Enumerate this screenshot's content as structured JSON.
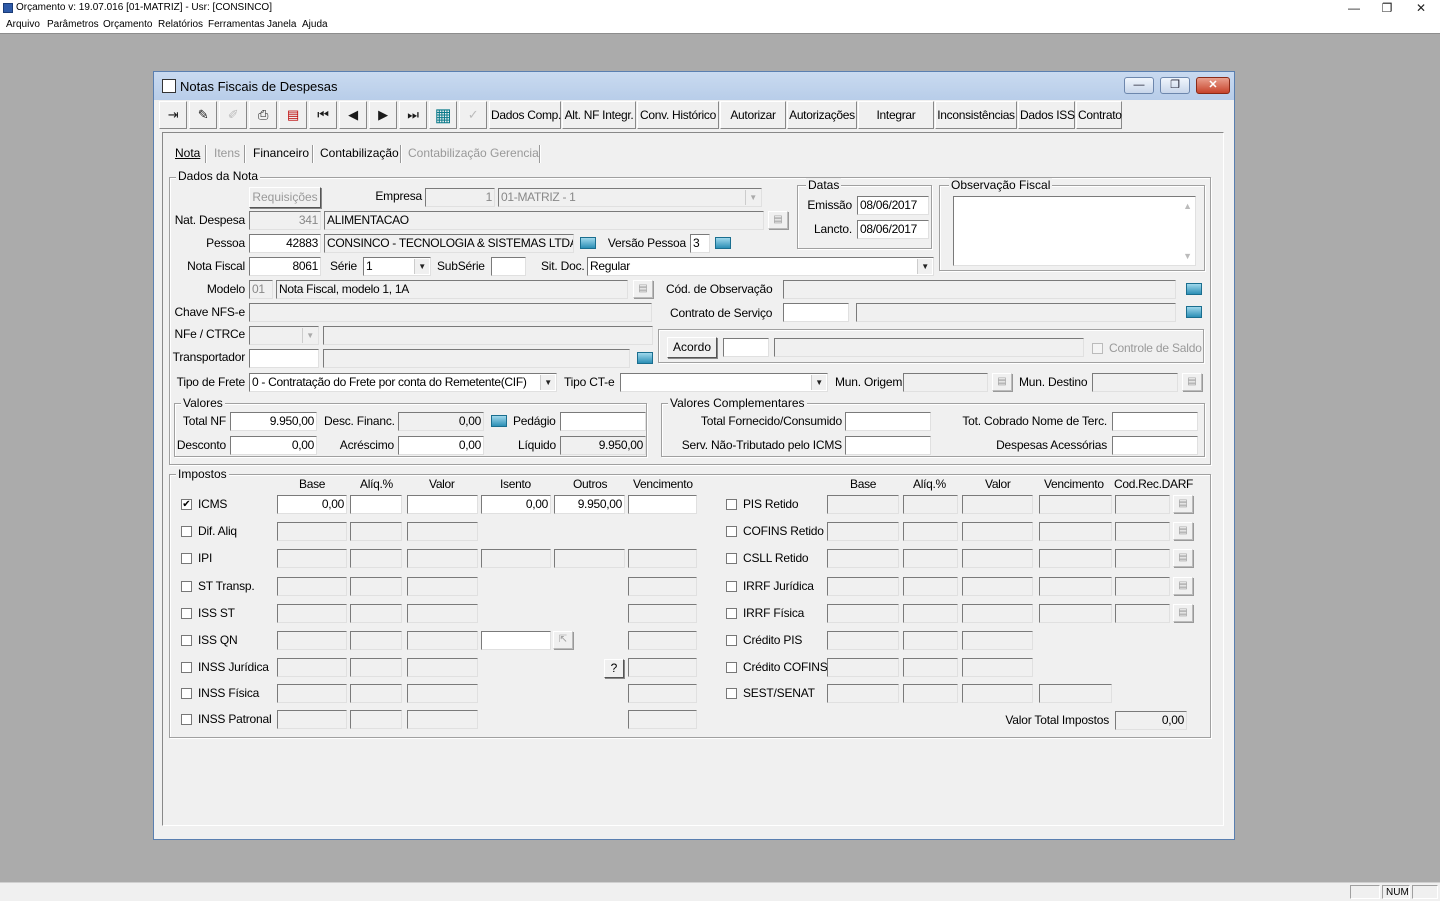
{
  "app": {
    "title": "Orçamento   v: 19.07.016   [01-MATRIZ] - Usr: [CONSINCO]",
    "menu": [
      "Arquivo",
      "Parâmetros",
      "Orçamento",
      "Relatórios",
      "Ferramentas",
      "Janela",
      "Ajuda"
    ],
    "window_controls": {
      "minimize": "—",
      "restore": "❐",
      "close": "✕"
    },
    "status": {
      "num": "NUM"
    }
  },
  "window": {
    "title": "Notas Fiscais de Despesas",
    "controls": {
      "minimize": "—",
      "restore": "❐",
      "close": "✕"
    }
  },
  "toolbar": {
    "icons": [
      "exit-icon",
      "eraser-icon",
      "edit-icon",
      "print-icon",
      "print-setup-icon",
      "first-icon",
      "prev-icon",
      "next-icon",
      "last-icon",
      "grid-icon",
      "sign-icon"
    ],
    "glyphs": {
      "exit": "⇥",
      "eraser": "✎",
      "edit": "✐",
      "print": "⎙",
      "print_setup": "▤",
      "first": "⏮",
      "prev": "◀",
      "next": "▶",
      "last": "⏭",
      "grid": "▦",
      "sign": "✓"
    },
    "buttons": [
      "Dados Comp.",
      "Alt. NF Integr.",
      "Conv. Histórico",
      "Autorizar",
      "Autorizações",
      "Integrar",
      "Inconsistências",
      "Dados ISS",
      "Contrato"
    ]
  },
  "tabs": [
    "Nota",
    "Itens",
    "Financeiro",
    "Contabilização",
    "Contabilização Gerencial"
  ],
  "dados_nota": {
    "group": "Dados da Nota",
    "requisicoes": "Requisições",
    "empresa_label": "Empresa",
    "empresa_code": "1",
    "empresa_name": "01-MATRIZ - 1",
    "nat_despesa_label": "Nat. Despesa",
    "nat_despesa_code": "341",
    "nat_despesa_name": "ALIMENTACAO",
    "pessoa_label": "Pessoa",
    "pessoa_code": "42883",
    "pessoa_name": "CONSINCO - TECNOLOGIA & SISTEMAS LTDA",
    "versao_label": "Versão Pessoa",
    "versao_value": "3",
    "nota_fiscal_label": "Nota Fiscal",
    "nota_fiscal_value": "8061",
    "serie_label": "Série",
    "serie_value": "1",
    "subserie_label": "SubSérie",
    "subserie_value": "",
    "sit_doc_label": "Sit. Doc.",
    "sit_doc_value": "Regular",
    "modelo_label": "Modelo",
    "modelo_code": "01",
    "modelo_name": "Nota Fiscal, modelo 1, 1A",
    "chave_label": "Chave NFS-e",
    "nfe_label": "NFe / CTRCe",
    "transportador_label": "Transportador",
    "cod_obs_label": "Cód. de Observação",
    "contrato_label": "Contrato de Serviço",
    "acordo": "Acordo",
    "controle_saldo": "Controle de Saldo",
    "tipo_frete_label": "Tipo de Frete",
    "tipo_frete_value": "0 - Contratação do Frete por conta do Remetente(CIF)",
    "tipo_cte_label": "Tipo CT-e",
    "mun_origem_label": "Mun. Origem",
    "mun_destino_label": "Mun. Destino"
  },
  "datas": {
    "group": "Datas",
    "emissao_label": "Emissão",
    "emissao": "08/06/2017",
    "lancto_label": "Lancto.",
    "lancto": "08/06/2017"
  },
  "obs_fiscal": {
    "group": "Observação Fiscal"
  },
  "valores": {
    "group": "Valores",
    "total_nf_label": "Total NF",
    "total_nf": "9.950,00",
    "desc_financ_label": "Desc. Financ.",
    "desc_financ": "0,00",
    "pedagio_label": "Pedágio",
    "desconto_label": "Desconto",
    "desconto": "0,00",
    "acrescimo_label": "Acréscimo",
    "acrescimo": "0,00",
    "liquido_label": "Líquido",
    "liquido": "9.950,00"
  },
  "valores_comp": {
    "group": "Valores Complementares",
    "total_fornecido": "Total Fornecido/Consumido",
    "tot_cobrado": "Tot. Cobrado Nome de Terc.",
    "serv_nao_trib": "Serv. Não-Tributado pelo ICMS",
    "despesas_acess": "Despesas Acessórias"
  },
  "impostos": {
    "group": "Impostos",
    "left_headers": [
      "Base",
      "Alíq.%",
      "Valor",
      "Isento",
      "Outros",
      "Vencimento"
    ],
    "right_headers": [
      "Base",
      "Alíq.%",
      "Valor",
      "Vencimento",
      "Cod.Rec.DARF"
    ],
    "left_rows": [
      {
        "label": "ICMS",
        "checked": "✔",
        "base": "0,00",
        "isento": "0,00",
        "outros": "9.950,00"
      },
      {
        "label": "Dif. Aliq",
        "checked": ""
      },
      {
        "label": "IPI",
        "checked": ""
      },
      {
        "label": "ST Transp.",
        "checked": ""
      },
      {
        "label": "ISS ST",
        "checked": ""
      },
      {
        "label": "ISS QN",
        "checked": ""
      },
      {
        "label": "INSS Jurídica",
        "checked": ""
      },
      {
        "label": "INSS Física",
        "checked": ""
      },
      {
        "label": "INSS Patronal",
        "checked": ""
      }
    ],
    "right_rows": [
      {
        "label": "PIS Retido"
      },
      {
        "label": "COFINS Retido"
      },
      {
        "label": "CSLL Retido"
      },
      {
        "label": "IRRF Jurídica"
      },
      {
        "label": "IRRF Física"
      },
      {
        "label": "Crédito PIS"
      },
      {
        "label": "Crédito COFINS"
      },
      {
        "label": "SEST/SENAT"
      }
    ],
    "help": "?",
    "valor_total_label": "Valor Total Impostos",
    "valor_total": "0,00"
  }
}
